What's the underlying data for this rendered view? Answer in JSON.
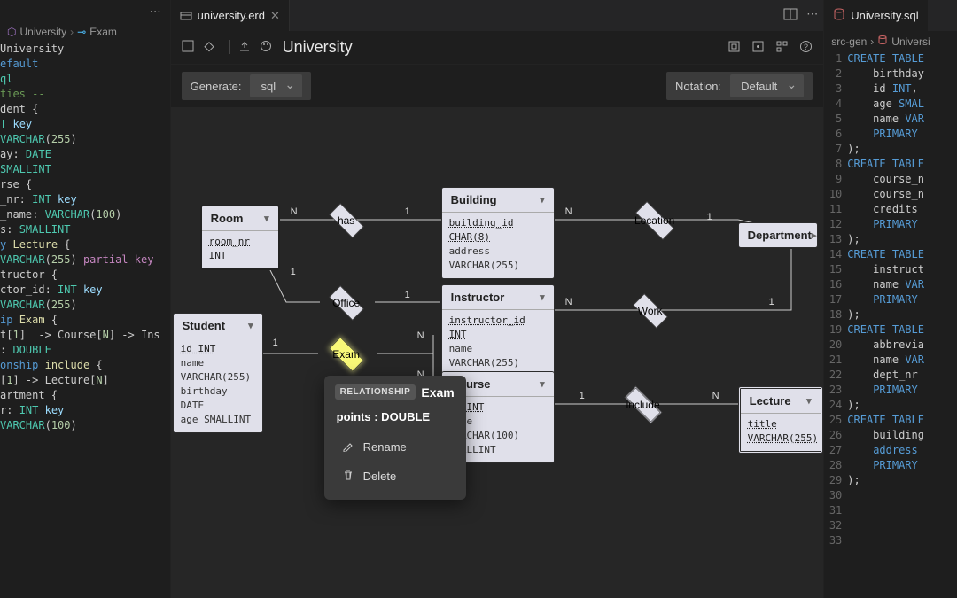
{
  "left_panel": {
    "breadcrumb": {
      "scope": "University",
      "current": "Exam"
    },
    "code_lines": [
      [
        {
          "c": "",
          "t": "University"
        }
      ],
      [
        {
          "c": "k-kw",
          "t": "efault"
        }
      ],
      [
        {
          "c": "k-type",
          "t": "ql"
        }
      ],
      [
        {
          "c": "",
          "t": ""
        }
      ],
      [
        {
          "c": "k-cmt",
          "t": "ties --"
        }
      ],
      [
        {
          "c": "",
          "t": "dent "
        },
        {
          "c": "",
          "t": "{"
        }
      ],
      [
        {
          "c": "k-type",
          "t": "T"
        },
        {
          "c": "",
          "t": " "
        },
        {
          "c": "k-id",
          "t": "key"
        }
      ],
      [
        {
          "c": "k-type",
          "t": "VARCHAR"
        },
        {
          "c": "",
          "t": "("
        },
        {
          "c": "k-lit",
          "t": "255"
        },
        {
          "c": "",
          "t": ")"
        }
      ],
      [
        {
          "c": "",
          "t": "ay: "
        },
        {
          "c": "k-type",
          "t": "DATE"
        }
      ],
      [
        {
          "c": "k-type",
          "t": "SMALLINT"
        }
      ],
      [
        {
          "c": "",
          "t": ""
        }
      ],
      [
        {
          "c": "",
          "t": "rse {"
        }
      ],
      [
        {
          "c": "",
          "t": "_nr: "
        },
        {
          "c": "k-type",
          "t": "INT"
        },
        {
          "c": "",
          "t": " "
        },
        {
          "c": "k-id",
          "t": "key"
        }
      ],
      [
        {
          "c": "",
          "t": "_name: "
        },
        {
          "c": "k-type",
          "t": "VARCHAR"
        },
        {
          "c": "",
          "t": "("
        },
        {
          "c": "k-lit",
          "t": "100"
        },
        {
          "c": "",
          "t": ")"
        }
      ],
      [
        {
          "c": "",
          "t": "s: "
        },
        {
          "c": "k-type",
          "t": "SMALLINT"
        }
      ],
      [
        {
          "c": "",
          "t": ""
        }
      ],
      [
        {
          "c": "k-kw",
          "t": "y"
        },
        {
          "c": "",
          "t": " "
        },
        {
          "c": "k-fn",
          "t": "Lecture"
        },
        {
          "c": "",
          "t": " {"
        }
      ],
      [
        {
          "c": "k-type",
          "t": "VARCHAR"
        },
        {
          "c": "",
          "t": "("
        },
        {
          "c": "k-lit",
          "t": "255"
        },
        {
          "c": "",
          "t": ") "
        },
        {
          "c": "k-pk",
          "t": "partial-key"
        }
      ],
      [
        {
          "c": "",
          "t": ""
        }
      ],
      [
        {
          "c": "",
          "t": "tructor {"
        }
      ],
      [
        {
          "c": "",
          "t": "ctor_id: "
        },
        {
          "c": "k-type",
          "t": "INT"
        },
        {
          "c": "",
          "t": " "
        },
        {
          "c": "k-id",
          "t": "key"
        }
      ],
      [
        {
          "c": "k-type",
          "t": "VARCHAR"
        },
        {
          "c": "",
          "t": "("
        },
        {
          "c": "k-lit",
          "t": "255"
        },
        {
          "c": "",
          "t": ")"
        }
      ],
      [
        {
          "c": "",
          "t": ""
        }
      ],
      [
        {
          "c": "k-kw",
          "t": "ip"
        },
        {
          "c": "",
          "t": " "
        },
        {
          "c": "k-fn",
          "t": "Exam"
        },
        {
          "c": "",
          "t": " {"
        }
      ],
      [
        {
          "c": "",
          "t": "t["
        },
        {
          "c": "k-lit",
          "t": "1"
        },
        {
          "c": "",
          "t": "]  -> Course["
        },
        {
          "c": "k-lit",
          "t": "N"
        },
        {
          "c": "",
          "t": "] -> Ins"
        }
      ],
      [
        {
          "c": "",
          "t": ": "
        },
        {
          "c": "k-type",
          "t": "DOUBLE"
        }
      ],
      [
        {
          "c": "",
          "t": ""
        }
      ],
      [
        {
          "c": "k-kw",
          "t": "onship"
        },
        {
          "c": "",
          "t": " "
        },
        {
          "c": "k-fn",
          "t": "include"
        },
        {
          "c": "",
          "t": " {"
        }
      ],
      [
        {
          "c": "",
          "t": "["
        },
        {
          "c": "k-lit",
          "t": "1"
        },
        {
          "c": "",
          "t": "] -> Lecture["
        },
        {
          "c": "k-lit",
          "t": "N"
        },
        {
          "c": "",
          "t": "]"
        }
      ],
      [
        {
          "c": "",
          "t": ""
        }
      ],
      [
        {
          "c": "",
          "t": "artment {"
        }
      ],
      [
        {
          "c": "",
          "t": "r: "
        },
        {
          "c": "k-type",
          "t": "INT"
        },
        {
          "c": "",
          "t": " "
        },
        {
          "c": "k-id",
          "t": "key"
        }
      ],
      [
        {
          "c": "k-type",
          "t": "VARCHAR"
        },
        {
          "c": "",
          "t": "("
        },
        {
          "c": "k-lit",
          "t": "100"
        },
        {
          "c": "",
          "t": ")"
        }
      ]
    ]
  },
  "center": {
    "tab_title": "university.erd",
    "diagram_title": "University",
    "generate_label": "Generate:",
    "generate_value": "sql",
    "notation_label": "Notation:",
    "notation_value": "Default",
    "entities": {
      "room": {
        "name": "Room",
        "attrs": [
          {
            "t": "room_nr  INT",
            "k": true
          }
        ]
      },
      "building": {
        "name": "Building",
        "attrs": [
          {
            "t": "building_id  CHAR(8)",
            "k": true
          },
          {
            "t": "address VARCHAR(255)",
            "k": false
          }
        ]
      },
      "department": {
        "name": "Department",
        "attrs": []
      },
      "student": {
        "name": "Student",
        "attrs": [
          {
            "t": "id  INT",
            "k": true
          },
          {
            "t": "name VARCHAR(255)",
            "k": false
          },
          {
            "t": "birthday DATE",
            "k": false
          },
          {
            "t": "age SMALLINT",
            "k": false
          }
        ]
      },
      "instructor": {
        "name": "Instructor",
        "attrs": [
          {
            "t": "instructor_id  INT",
            "k": true
          },
          {
            "t": "name VARCHAR(255)",
            "k": false
          }
        ]
      },
      "course": {
        "name": "Course",
        "attrs": [
          {
            "t": "nr  INT",
            "k": true
          },
          {
            "t": "name VARCHAR(100)",
            "k": false
          },
          {
            "t": "SMALLINT",
            "k": false
          }
        ]
      },
      "lecture": {
        "name": "Lecture",
        "attrs": [
          {
            "t": "title VARCHAR(255)",
            "k": true
          }
        ]
      }
    },
    "relations": {
      "has": {
        "label": "has"
      },
      "location": {
        "label": "Location"
      },
      "office": {
        "label": "Office"
      },
      "work": {
        "label": "Work"
      },
      "exam": {
        "label": "Exam"
      },
      "include": {
        "label": "include"
      }
    },
    "cards": {
      "one": "1",
      "many": "N"
    },
    "popup": {
      "chip": "RELATIONSHIP",
      "title": "Exam",
      "attr": "points : DOUBLE",
      "rename": "Rename",
      "delete": "Delete"
    }
  },
  "right_panel": {
    "tab_title": "University.sql",
    "breadcrumb": {
      "folder": "src-gen",
      "file": "Universi"
    },
    "lines": [
      [
        {
          "c": "k-kw",
          "t": "CREATE TABLE"
        }
      ],
      [
        {
          "c": "",
          "t": "    birthday"
        }
      ],
      [
        {
          "c": "",
          "t": "    id "
        },
        {
          "c": "k-kw",
          "t": "INT"
        },
        {
          "c": "",
          "t": ","
        }
      ],
      [
        {
          "c": "",
          "t": "    age "
        },
        {
          "c": "k-kw",
          "t": "SMAL"
        }
      ],
      [
        {
          "c": "",
          "t": "    name "
        },
        {
          "c": "k-kw",
          "t": "VAR"
        }
      ],
      [
        {
          "c": "",
          "t": "    "
        },
        {
          "c": "k-kw",
          "t": "PRIMARY"
        }
      ],
      [
        {
          "c": "",
          "t": ");"
        }
      ],
      [
        {
          "c": "",
          "t": ""
        }
      ],
      [
        {
          "c": "k-kw",
          "t": "CREATE TABLE"
        }
      ],
      [
        {
          "c": "",
          "t": "    course_n"
        }
      ],
      [
        {
          "c": "",
          "t": "    course_n"
        }
      ],
      [
        {
          "c": "",
          "t": "    credits"
        }
      ],
      [
        {
          "c": "",
          "t": "    "
        },
        {
          "c": "k-kw",
          "t": "PRIMARY"
        }
      ],
      [
        {
          "c": "",
          "t": ");"
        }
      ],
      [
        {
          "c": "",
          "t": ""
        }
      ],
      [
        {
          "c": "k-kw",
          "t": "CREATE TABLE"
        }
      ],
      [
        {
          "c": "",
          "t": "    instruct"
        }
      ],
      [
        {
          "c": "",
          "t": "    name "
        },
        {
          "c": "k-kw",
          "t": "VAR"
        }
      ],
      [
        {
          "c": "",
          "t": "    "
        },
        {
          "c": "k-kw",
          "t": "PRIMARY"
        }
      ],
      [
        {
          "c": "",
          "t": ");"
        }
      ],
      [
        {
          "c": "",
          "t": ""
        }
      ],
      [
        {
          "c": "k-kw",
          "t": "CREATE TABLE"
        }
      ],
      [
        {
          "c": "",
          "t": "    abbrevia"
        }
      ],
      [
        {
          "c": "",
          "t": "    name "
        },
        {
          "c": "k-kw",
          "t": "VAR"
        }
      ],
      [
        {
          "c": "",
          "t": "    dept_nr"
        }
      ],
      [
        {
          "c": "",
          "t": "    "
        },
        {
          "c": "k-kw",
          "t": "PRIMARY"
        }
      ],
      [
        {
          "c": "",
          "t": ");"
        }
      ],
      [
        {
          "c": "",
          "t": ""
        }
      ],
      [
        {
          "c": "k-kw",
          "t": "CREATE TABLE"
        }
      ],
      [
        {
          "c": "",
          "t": "    building"
        }
      ],
      [
        {
          "c": "",
          "t": "    "
        },
        {
          "c": "k-kw",
          "t": "address"
        }
      ],
      [
        {
          "c": "",
          "t": "    "
        },
        {
          "c": "k-kw",
          "t": "PRIMARY"
        }
      ],
      [
        {
          "c": "",
          "t": ");"
        }
      ]
    ]
  }
}
